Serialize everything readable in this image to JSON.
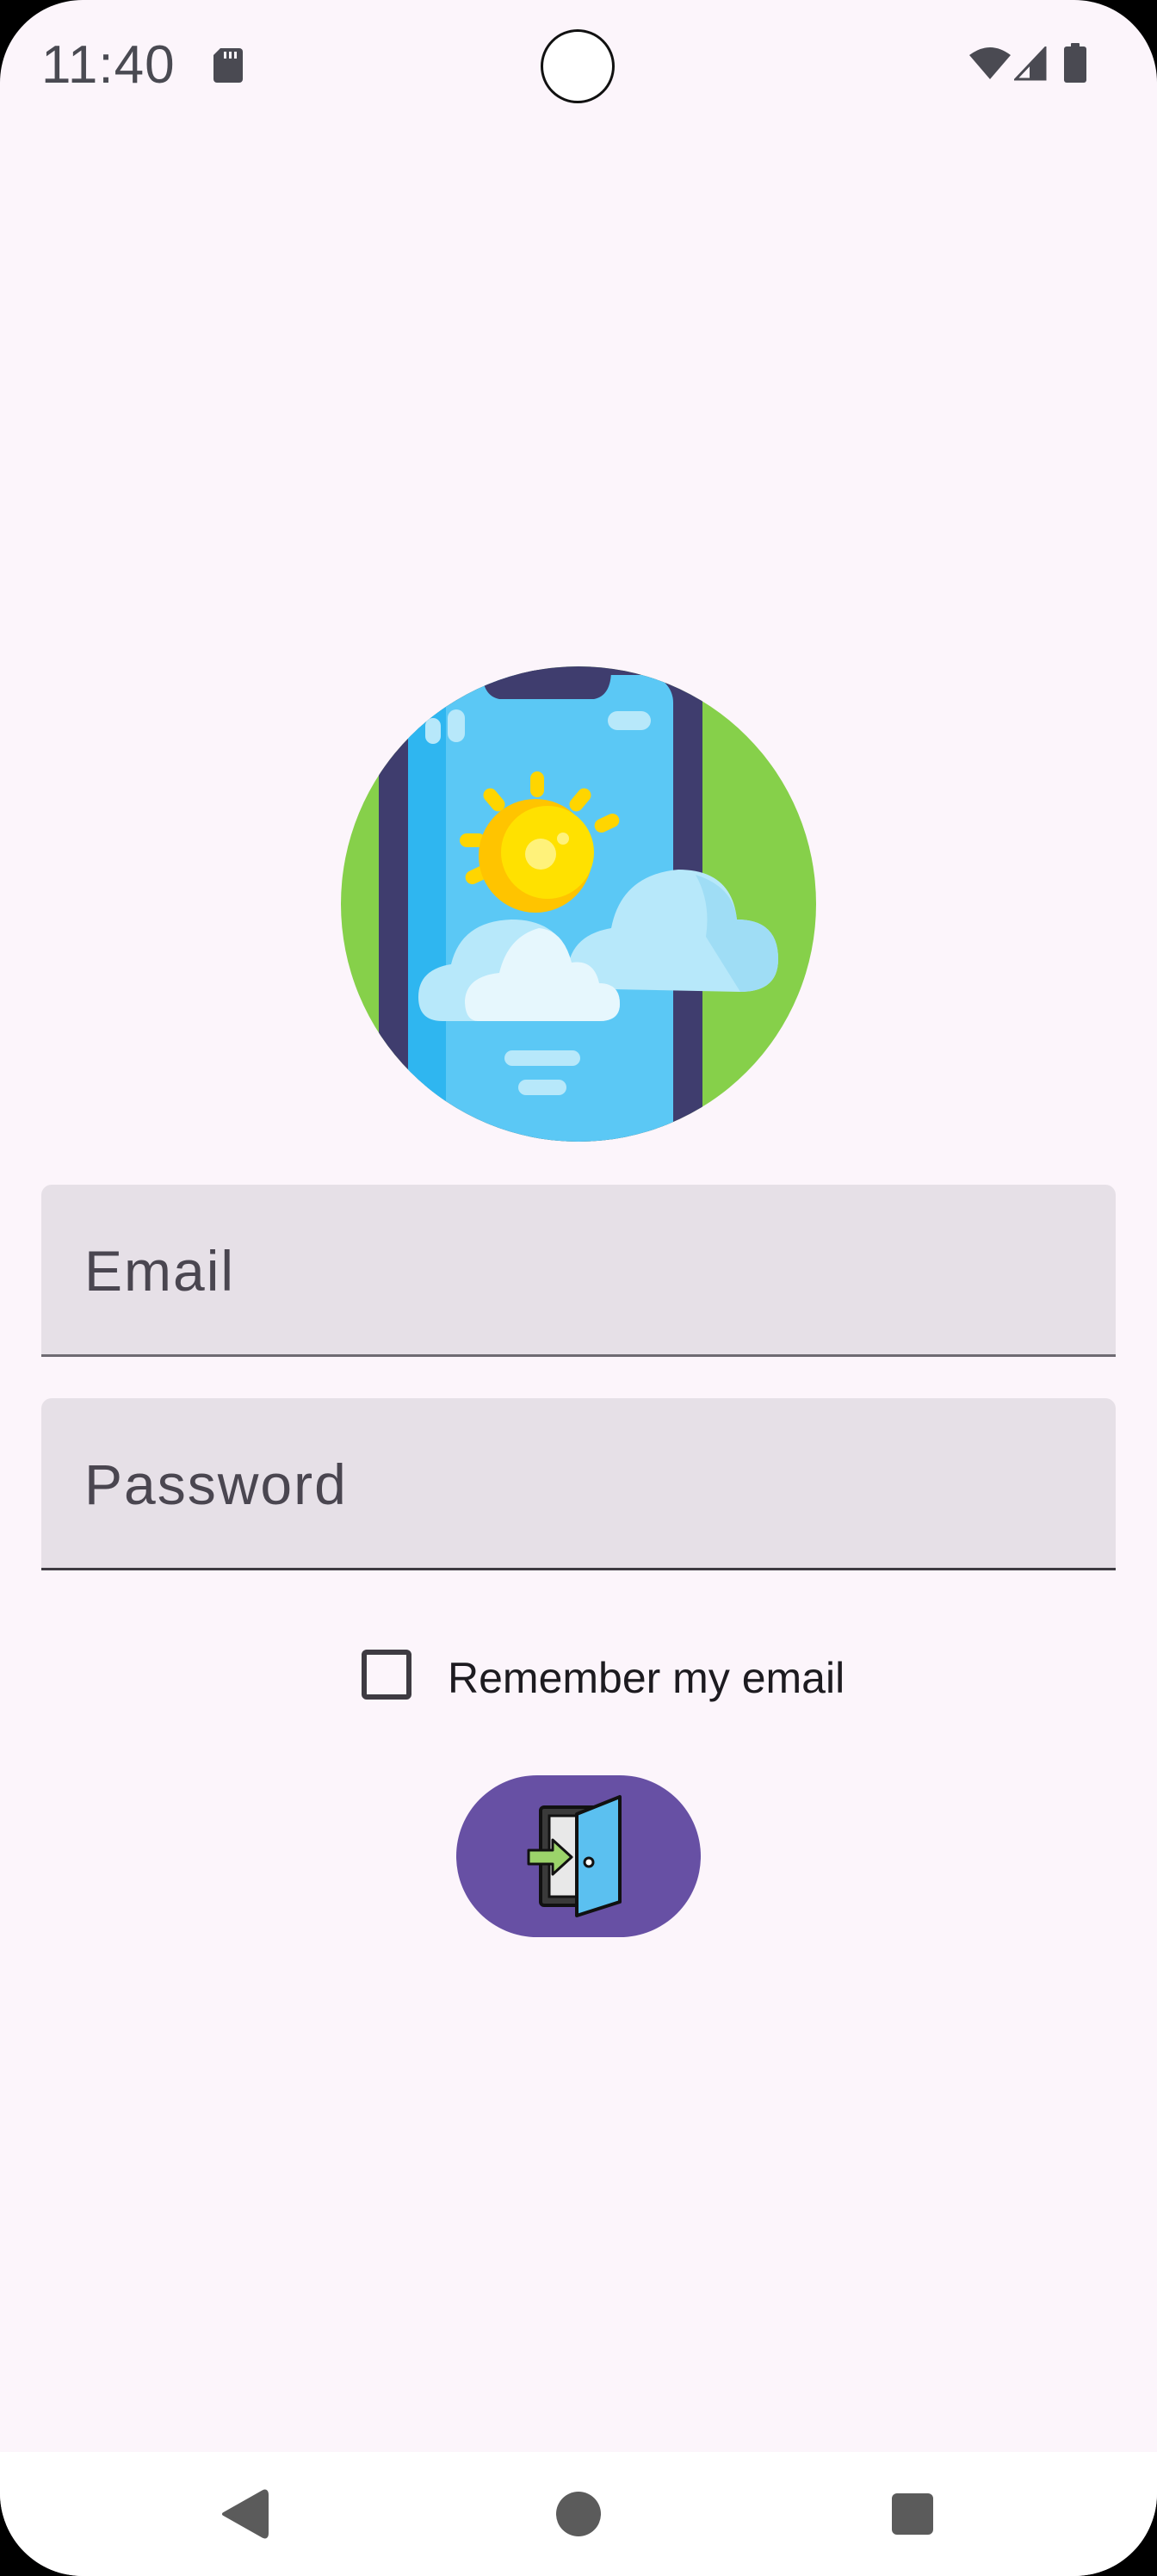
{
  "status_bar": {
    "time": "11:40",
    "icons": [
      "sd-card-icon",
      "wifi-icon",
      "cellular-signal-icon",
      "battery-icon"
    ]
  },
  "logo": {
    "icon": "weather-phone-logo",
    "colors": {
      "circle": "#86D04A",
      "phone_frame": "#3F3D6E",
      "screen": "#5BC8F5",
      "sun": "#FFD500",
      "cloud": "#B7E8FA"
    }
  },
  "form": {
    "email_label": "Email",
    "password_label": "Password",
    "remember_label": "Remember my email",
    "remember_checked": false,
    "login_button_icon": "login-door-icon"
  },
  "nav_bar": {
    "icons": [
      "back-icon",
      "home-icon",
      "recents-icon"
    ]
  },
  "colors": {
    "background": "#FCF5FB",
    "field_background": "#E6E0E7",
    "primary": "#6750A4"
  }
}
